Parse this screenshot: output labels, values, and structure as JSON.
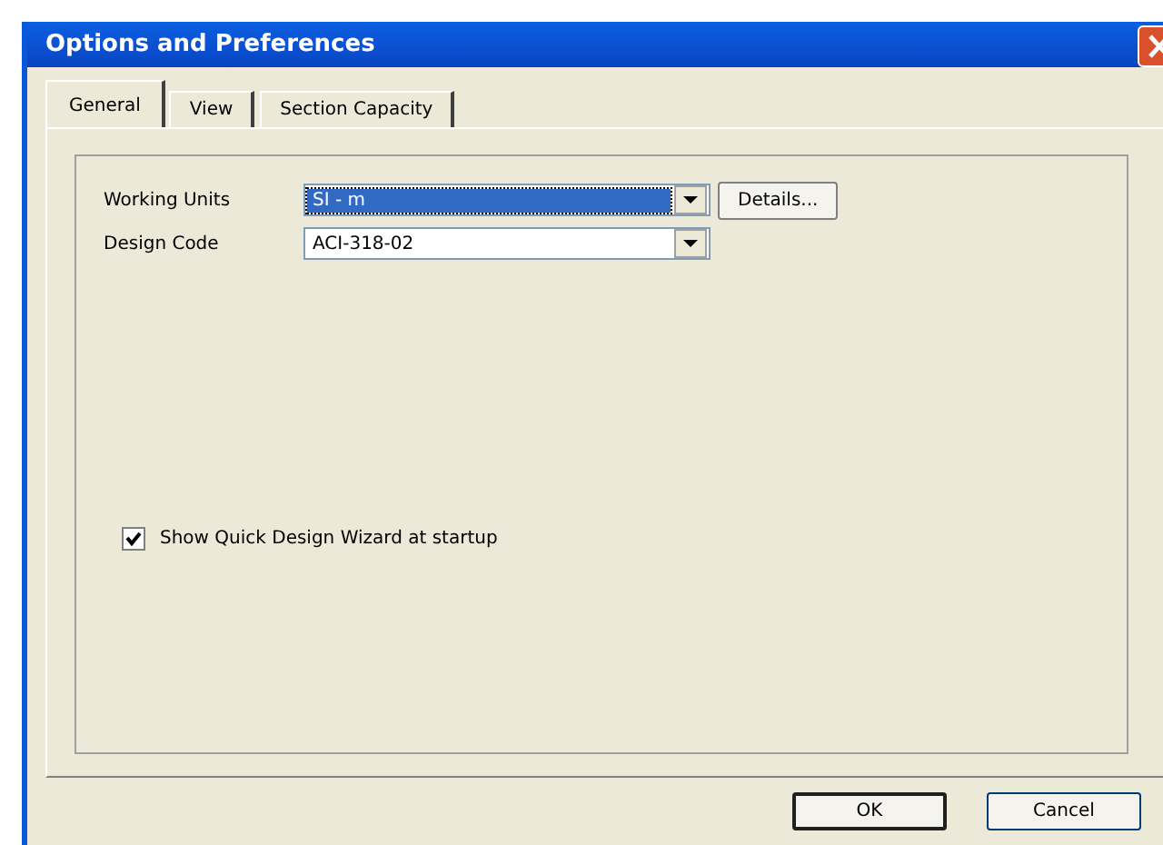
{
  "window": {
    "title": "Options and Preferences"
  },
  "tabs": [
    {
      "label": "General",
      "selected": true
    },
    {
      "label": "View",
      "selected": false
    },
    {
      "label": "Section Capacity",
      "selected": false
    }
  ],
  "fields": [
    {
      "label": "Working Units",
      "value": "SI - m",
      "focused": true,
      "button": "Details..."
    },
    {
      "label": "Design Code",
      "value": "ACI-318-02",
      "focused": false
    }
  ],
  "checkbox": {
    "label": "Show Quick Design Wizard at startup",
    "checked": true
  },
  "buttons": [
    {
      "label": "OK",
      "default": true
    },
    {
      "label": "Cancel",
      "default": false
    }
  ]
}
